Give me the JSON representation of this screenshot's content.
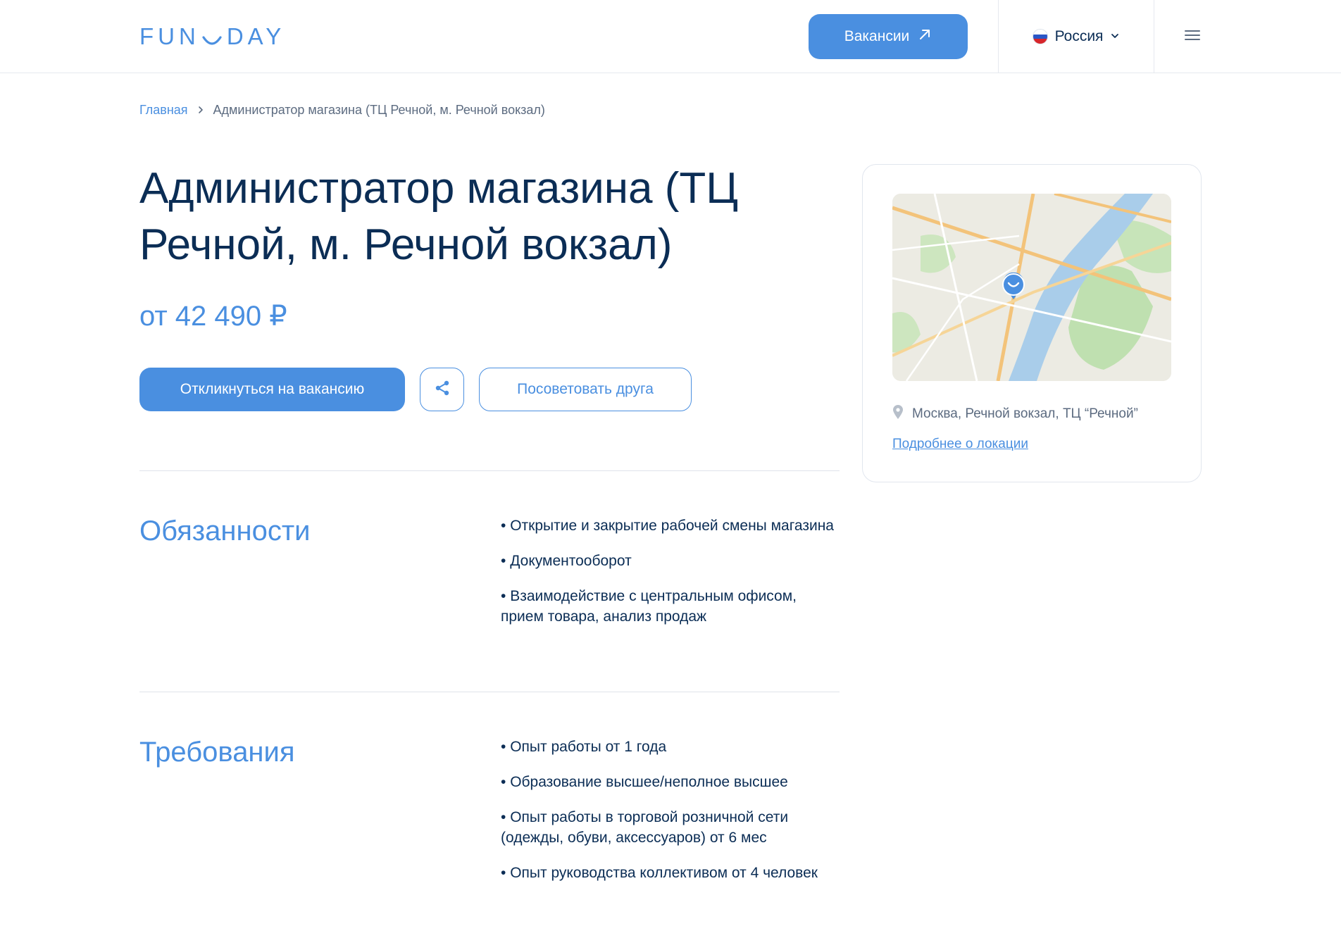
{
  "header": {
    "logo_left": "FUN",
    "logo_right": "DAY",
    "vacancies_label": "Вакансии",
    "country_label": "Россия",
    "icons": [
      "arrow-up-right-icon",
      "chevron-down-icon",
      "hamburger-menu-icon",
      "russia-flag-icon"
    ]
  },
  "breadcrumb": {
    "home": "Главная",
    "current": "Администратор магазина (ТЦ Речной, м. Речной вокзал)"
  },
  "job": {
    "title": "Администратор магазина (ТЦ Речной, м. Речной вокзал)",
    "price": "от 42 490 ₽",
    "apply_label": "Откликнуться на вакансию",
    "recommend_label": "Посоветовать друга"
  },
  "duties": {
    "title": "Обязанности",
    "items": [
      "Открытие и закрытие рабочей смены магазина",
      "Документооборот",
      "Взаимодействие с центральным офисом, прием товара, анализ продаж"
    ]
  },
  "requirements": {
    "title": "Требования",
    "items": [
      "Опыт работы от 1 года",
      "Образование высшее/неполное высшее",
      "Опыт работы в торговой розничной сети (одежды, обуви, аксессуаров) от 6 мес",
      "Опыт руководства коллективом от 4 человек"
    ]
  },
  "location": {
    "address": "Москва, Речной вокзал, ТЦ “Речной”",
    "more_link": "Подробнее о локации"
  },
  "colors": {
    "accent": "#4a8fe0",
    "text_dark": "#0b2d55",
    "text_muted": "#5c6b80"
  }
}
